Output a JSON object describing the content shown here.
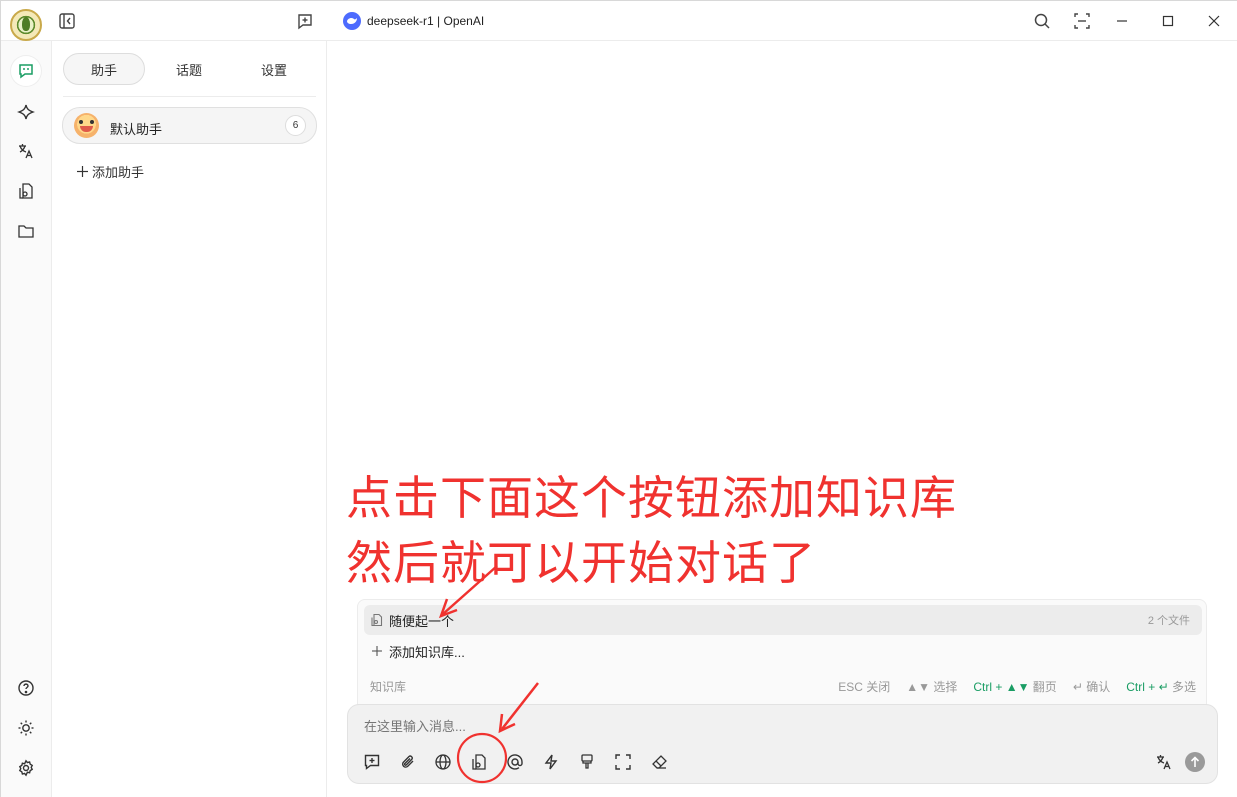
{
  "titlebar": {
    "model_label": "deepseek-r1 | OpenAI"
  },
  "sidebar": {
    "tabs": [
      {
        "label": "助手",
        "active": true
      },
      {
        "label": "话题",
        "active": false
      },
      {
        "label": "设置",
        "active": false
      }
    ],
    "assistant": {
      "name": "默认助手",
      "count": "6"
    },
    "add_assistant_label": "添加助手"
  },
  "annotation": {
    "line1": "点击下面这个按钮添加知识库",
    "line2": "然后就可以开始对话了",
    "color": "#f0322f"
  },
  "knowledge_panel": {
    "items": [
      {
        "label": "随便起一个",
        "files": "2 个文件",
        "selected": true
      },
      {
        "label": "添加知识库...",
        "files": "",
        "selected": false
      }
    ],
    "footer_title": "知识库",
    "shortcuts": [
      {
        "key": "ESC",
        "action": "关闭"
      },
      {
        "key": "▲▼",
        "action": "选择"
      },
      {
        "key": "Ctrl + ▲▼",
        "action": "翻页"
      },
      {
        "key": "↵",
        "action": "确认"
      },
      {
        "key": "Ctrl + ↵",
        "action": "多选"
      }
    ]
  },
  "input": {
    "placeholder": "在这里输入消息..."
  },
  "icons": {
    "nav": [
      "chat-icon",
      "sparkle-icon",
      "translate-icon",
      "knowledge-icon",
      "folder-icon",
      "help-icon",
      "theme-icon",
      "settings-icon"
    ],
    "toolbar": [
      "new-topic-icon",
      "attachment-icon",
      "web-search-icon",
      "knowledge-base-icon",
      "mention-icon",
      "quick-phrase-icon",
      "brush-icon",
      "expand-icon",
      "eraser-icon",
      "translate-icon",
      "send-icon"
    ]
  },
  "colors": {
    "accent": "#1a9d64",
    "model_badge": "#4d6bfe"
  }
}
